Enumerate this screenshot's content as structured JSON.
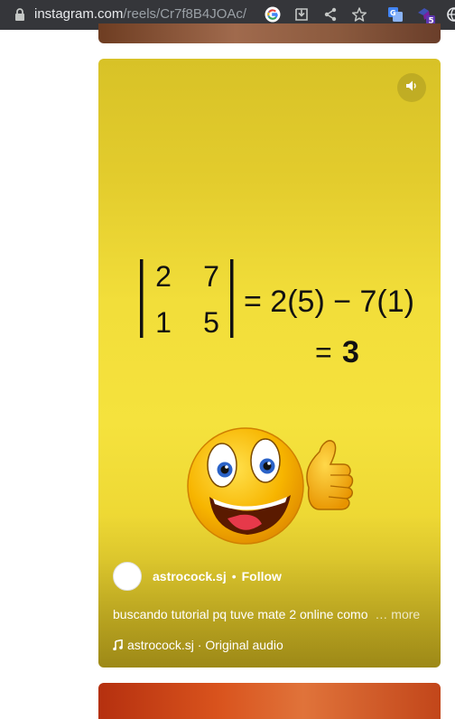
{
  "browser": {
    "url_host": "instagram.com",
    "url_path": "/reels/Cr7f8B4JOAc/",
    "extension_badge": "5"
  },
  "reel": {
    "math": {
      "matrix_row1": [
        "2",
        "7"
      ],
      "matrix_row2": [
        "1",
        "5"
      ],
      "equation_line1": "= 2(5) − 7(1)",
      "equation_line2_eq": "=",
      "equation_line2_result": "3"
    },
    "author": {
      "username": "astrocock.sj",
      "separator": "•",
      "follow_label": "Follow"
    },
    "caption": {
      "text": "buscando tutorial pq tuve mate 2 online como",
      "more_label": "… more"
    },
    "audio": {
      "label": "astrocock.sj · Original audio"
    }
  },
  "colors": {
    "reel_yellow": "#f5e23d",
    "browser_bar": "#35363a"
  }
}
